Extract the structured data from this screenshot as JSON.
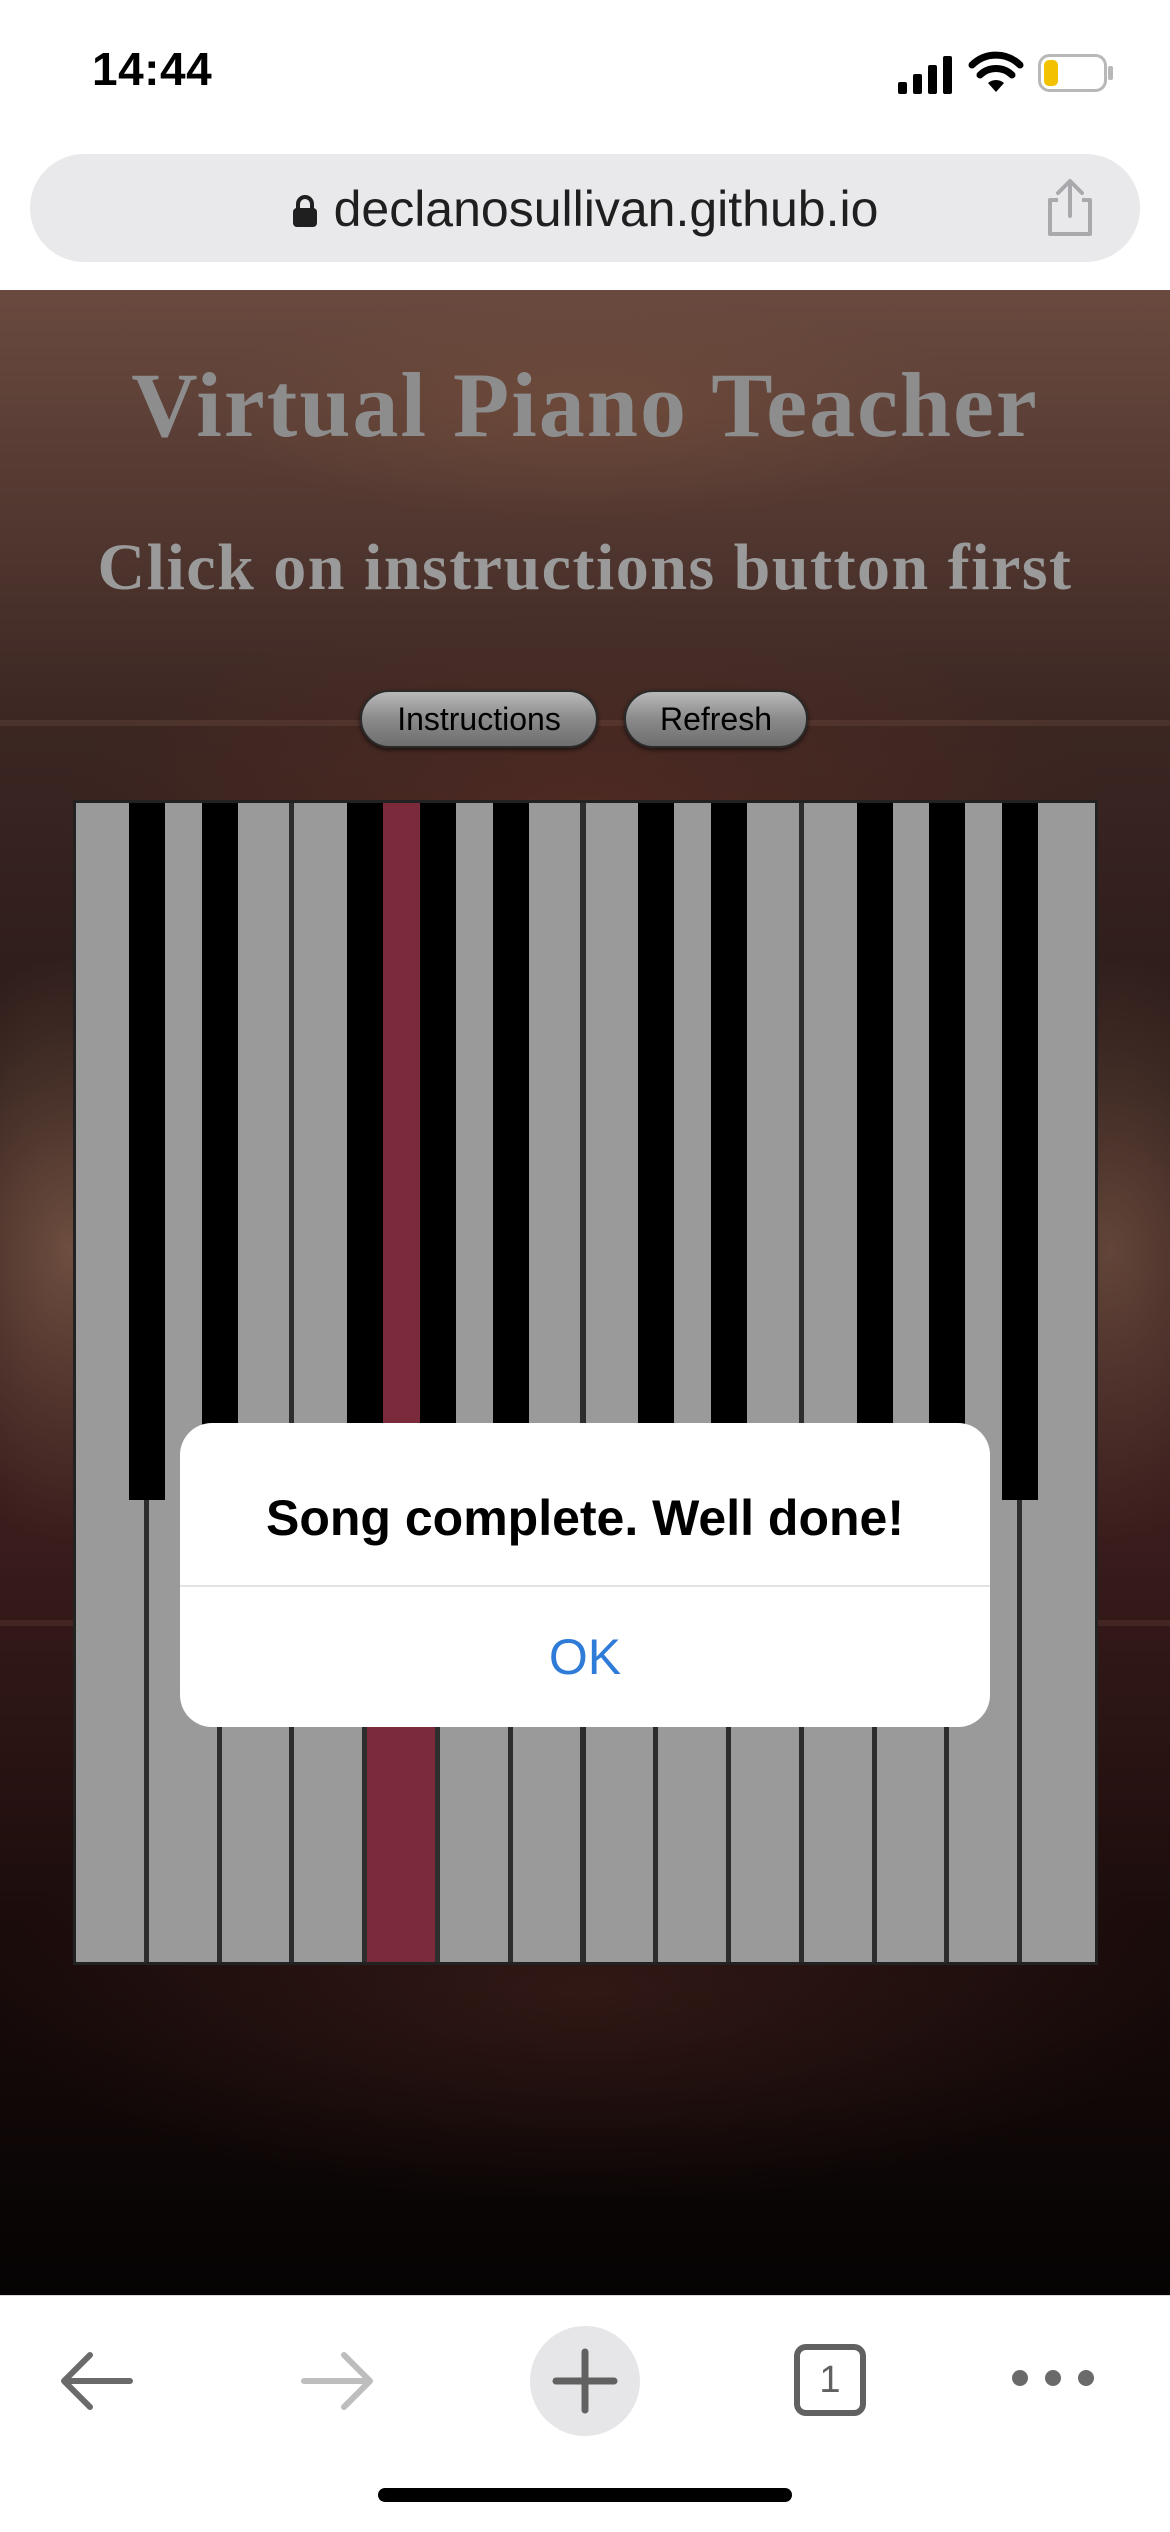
{
  "status_bar": {
    "time": "14:44",
    "icons": [
      "signal-icon",
      "wifi-icon",
      "battery-icon"
    ],
    "battery_color": "#f2c200"
  },
  "browser": {
    "url": "declanosullivan.github.io",
    "tab_count": "1",
    "toolbar_icons": [
      "back-icon",
      "forward-icon",
      "plus-icon",
      "tabs-icon",
      "more-icon"
    ]
  },
  "page": {
    "title": "Virtual Piano Teacher",
    "subtitle": "Click on instructions button first",
    "buttons": {
      "instructions": "Instructions",
      "refresh": "Refresh"
    }
  },
  "piano": {
    "white_key_count": 14,
    "highlighted_white_key_index": 4,
    "black_key_positions_after_white_index": [
      0,
      1,
      3,
      4,
      5,
      7,
      8,
      10,
      11,
      12
    ],
    "key_color": "#9a9a9a",
    "black_key_color": "#000000",
    "highlight_color": "#7a2a3a"
  },
  "alert": {
    "message": "Song complete. Well done!",
    "ok_label": "OK",
    "accent_color": "#2f7bd8"
  }
}
